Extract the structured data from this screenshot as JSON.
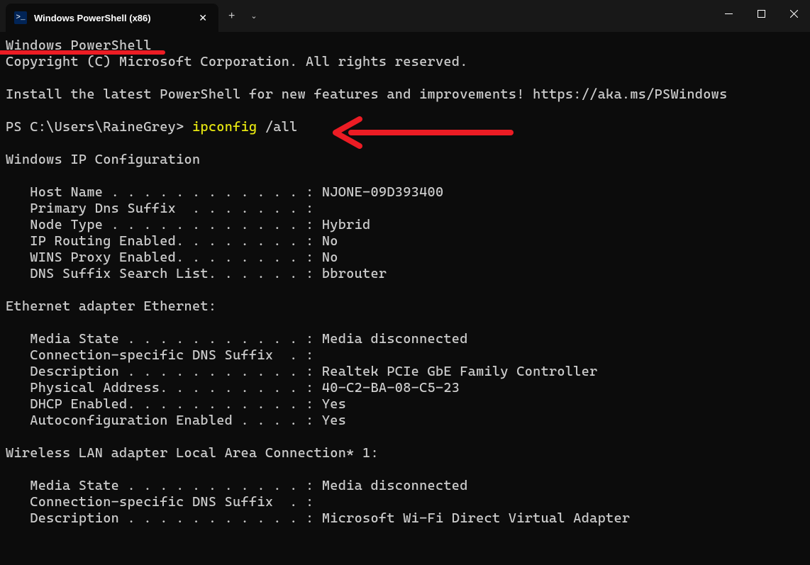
{
  "titlebar": {
    "tab_title": "Windows PowerShell (x86)",
    "close_symbol": "✕",
    "new_tab_symbol": "+",
    "dropdown_symbol": "⌄",
    "minimize_symbol": "—",
    "maximize_symbol": "▢",
    "window_close_symbol": "✕",
    "tab_icon_text": ">_"
  },
  "terminal": {
    "header_line_1": "Windows PowerShell",
    "header_line_2": "Copyright (C) Microsoft Corporation. All rights reserved.",
    "install_message": "Install the latest PowerShell for new features and improvements! https://aka.ms/PSWindows",
    "prompt": "PS C:\\Users\\RaineGrey> ",
    "command": "ipconfig",
    "command_args": " /all",
    "section_ipconfig": "Windows IP Configuration",
    "ipconfig_lines": [
      "   Host Name . . . . . . . . . . . . : NJONE-09D393400",
      "   Primary Dns Suffix  . . . . . . . :",
      "   Node Type . . . . . . . . . . . . : Hybrid",
      "   IP Routing Enabled. . . . . . . . : No",
      "   WINS Proxy Enabled. . . . . . . . : No",
      "   DNS Suffix Search List. . . . . . : bbrouter"
    ],
    "section_ethernet": "Ethernet adapter Ethernet:",
    "ethernet_lines": [
      "   Media State . . . . . . . . . . . : Media disconnected",
      "   Connection-specific DNS Suffix  . :",
      "   Description . . . . . . . . . . . : Realtek PCIe GbE Family Controller",
      "   Physical Address. . . . . . . . . : 40-C2-BA-08-C5-23",
      "   DHCP Enabled. . . . . . . . . . . : Yes",
      "   Autoconfiguration Enabled . . . . : Yes"
    ],
    "section_wlan": "Wireless LAN adapter Local Area Connection* 1:",
    "wlan_lines": [
      "   Media State . . . . . . . . . . . : Media disconnected",
      "   Connection-specific DNS Suffix  . :",
      "   Description . . . . . . . . . . . : Microsoft Wi-Fi Direct Virtual Adapter"
    ]
  }
}
